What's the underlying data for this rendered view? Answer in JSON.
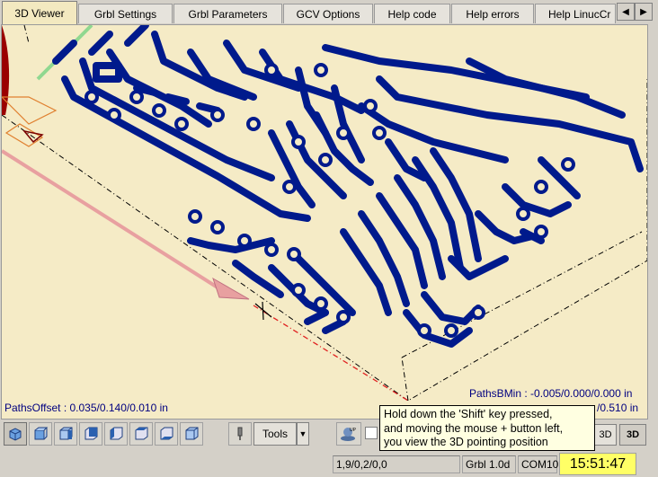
{
  "tabs": [
    {
      "label": "3D Viewer",
      "active": true
    },
    {
      "label": "Grbl Settings"
    },
    {
      "label": "Grbl Parameters"
    },
    {
      "label": "GCV Options"
    },
    {
      "label": "Help code"
    },
    {
      "label": "Help errors"
    },
    {
      "label": "Help LinucCr"
    }
  ],
  "tab_scroll": {
    "left": "◀",
    "right": "▶"
  },
  "viewer": {
    "paths_offset": "PathsOffset : 0.035/0.140/0.010 in",
    "paths_bmin": "PathsBMin : -0.005/0.000/0.000 in",
    "paths_bmax_partial": "/0.510 in",
    "trace_color": "#001a8c",
    "background_color": "#f5ebc6"
  },
  "toolbar": {
    "view_buttons": [
      "view-iso-icon",
      "view-front-icon",
      "view-right-icon",
      "view-back-icon",
      "view-left-icon",
      "view-top-icon",
      "view-bottom-icon",
      "view-fit-icon"
    ],
    "tools_label": "Tools",
    "tools_arrow": "▼",
    "btn_3d_a": "3D",
    "btn_3d_b": "3D"
  },
  "tooltip": {
    "line1": "Hold down the 'Shift' key pressed,",
    "line2": "and moving the mouse + button left,",
    "line3": "you view the 3D pointing position"
  },
  "status": {
    "coords": "1,9/0,2/0,0",
    "grbl": "Grbl 1.0d",
    "port": "COM10",
    "time": "15:51:47"
  }
}
